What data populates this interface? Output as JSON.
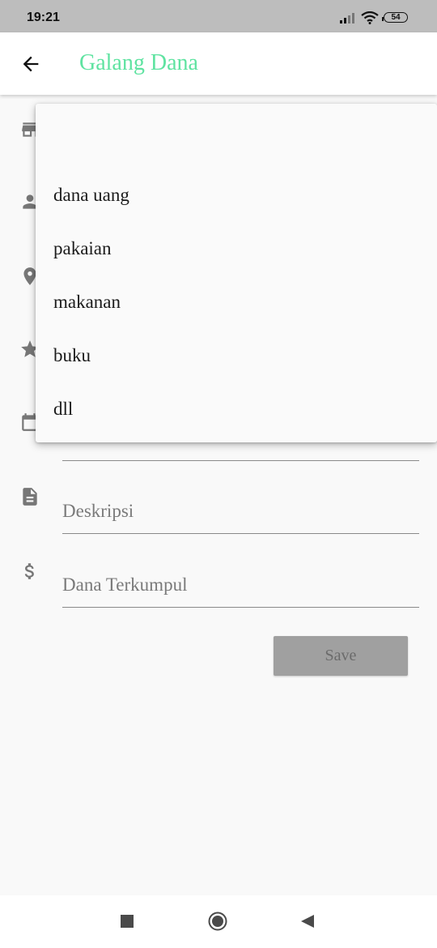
{
  "status_bar": {
    "time": "19:21",
    "battery": "54"
  },
  "app_bar": {
    "title": "Galang Dana",
    "title_color": "#5fe3a1"
  },
  "dropdown": {
    "items": [
      "dana uang",
      "pakaian",
      "makanan",
      "buku",
      "dll"
    ]
  },
  "form": {
    "fields": [
      "Deskripsi",
      "Dana Terkumpul"
    ],
    "icons": [
      "store-icon",
      "person-icon",
      "location-icon",
      "star-icon",
      "calendar-icon",
      "description-icon",
      "dollar-icon"
    ]
  },
  "save_label": "Save"
}
